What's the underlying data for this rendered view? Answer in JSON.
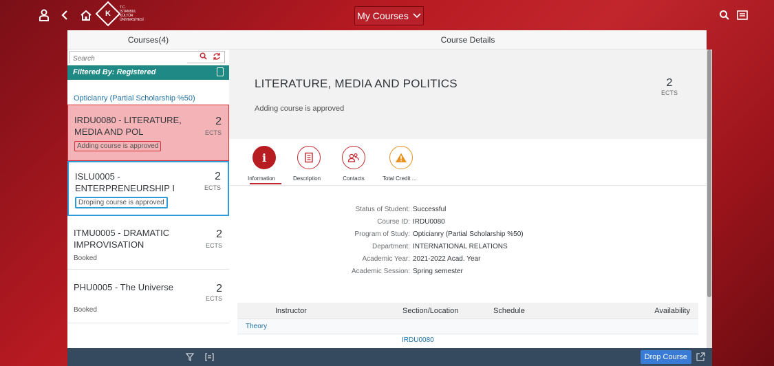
{
  "header": {
    "logo_lines": [
      "T.C.",
      "İSTANBUL",
      "KÜLTÜR",
      "ÜNİVERSİTESİ"
    ],
    "title": "My Courses"
  },
  "left": {
    "title": "Courses(4)",
    "search_placeholder": "Search",
    "filter_text": "Filtered By: Registered",
    "group_label": "Opticianry (Partial Scholarship %50)",
    "items": [
      {
        "name": "IRDU0080 - LITERATURE, MEDIA AND POL",
        "ects": "2",
        "ects_label": "ECTS",
        "status": "Adding course is approved"
      },
      {
        "name": "ISLU0005 - ENTERPRENEURSHIP I",
        "ects": "2",
        "ects_label": "ECTS",
        "status": "Dropiing course is approved"
      },
      {
        "name": "ITMU0005 - DRAMATIC IMPROVISATION",
        "ects": "2",
        "ects_label": "ECTS",
        "status": "Booked"
      },
      {
        "name": "PHU0005 - The Universe",
        "ects": "2",
        "ects_label": "ECTS",
        "status": "Booked"
      }
    ]
  },
  "right": {
    "title": "Course Details",
    "course_title": "LITERATURE, MEDIA AND POLITICS",
    "course_status": "Adding course is approved",
    "ects": "2",
    "ects_label": "ECTS",
    "tabs": [
      {
        "label": "Information",
        "icon": "info-icon"
      },
      {
        "label": "Description",
        "icon": "document-icon"
      },
      {
        "label": "Contacts",
        "icon": "contacts-icon"
      },
      {
        "label": "Total Credit ...",
        "icon": "warning-icon"
      }
    ],
    "details": [
      {
        "key": "Status of Student:",
        "value": "Successful"
      },
      {
        "key": "Course ID:",
        "value": "IRDU0080"
      },
      {
        "key": "Program of Study:",
        "value": "Opticianry (Partial Scholarship %50)"
      },
      {
        "key": "Department:",
        "value": "INTERNATIONAL RELATIONS"
      },
      {
        "key": "Academic Year:",
        "value": "2021-2022 Acad. Year"
      },
      {
        "key": "Academic Session:",
        "value": "Spring semester"
      }
    ],
    "table": {
      "columns": [
        "Instructor",
        "Section/Location",
        "Schedule",
        "Availability"
      ],
      "group": "Theory",
      "section": "IRDU0080"
    },
    "drop_label": "Drop Course"
  },
  "colors": {
    "brand": "#c2262d",
    "teal": "#1f8a85",
    "footer": "#354a5f",
    "button": "#3a7bd5"
  }
}
